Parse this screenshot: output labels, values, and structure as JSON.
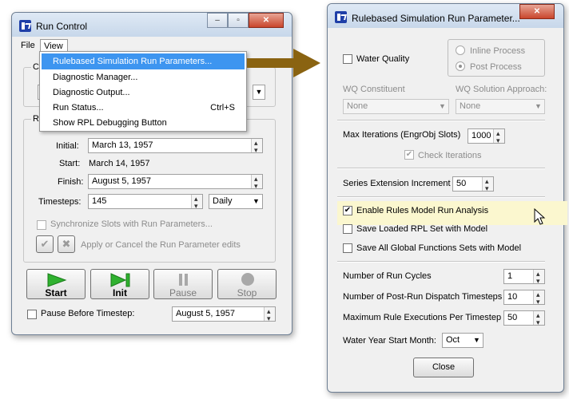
{
  "run_control": {
    "title": "Run Control",
    "menubar": {
      "file": "File",
      "view": "View"
    },
    "view_menu": [
      {
        "label": "Rulebased Simulation Run Parameters...",
        "shortcut": ""
      },
      {
        "label": "Diagnostic Manager...",
        "shortcut": ""
      },
      {
        "label": "Diagnostic Output...",
        "shortcut": ""
      },
      {
        "label": "Run Status...",
        "shortcut": "Ctrl+S"
      },
      {
        "label": "Show RPL Debugging Button",
        "shortcut": ""
      }
    ],
    "group1_title_fragment": "C",
    "group2_title_fragment": "R",
    "initial_label": "Initial:",
    "initial_value": "March 13, 1957",
    "start_label": "Start:",
    "start_value": "March 14, 1957",
    "finish_label": "Finish:",
    "finish_value": "August 5, 1957",
    "timesteps_label": "Timesteps:",
    "timesteps_value": "145",
    "timestep_unit": "Daily",
    "sync_label": "Synchronize Slots with Run Parameters...",
    "apply_label": "Apply or Cancel the Run Parameter edits",
    "buttons": {
      "start": "Start",
      "init": "Init",
      "pause": "Pause",
      "stop": "Stop"
    },
    "pause_before_label": "Pause Before Timestep:",
    "pause_before_value": "August 5, 1957"
  },
  "rbs": {
    "title": "Rulebased Simulation Run Parameter...",
    "water_quality_label": "Water Quality",
    "inline_process": "Inline Process",
    "post_process": "Post Process",
    "wq_constituent_label": "WQ Constituent",
    "wq_constituent_value": "None",
    "wq_solution_label": "WQ Solution Approach:",
    "wq_solution_value": "None",
    "max_iter_label": "Max Iterations  (EngrObj Slots)",
    "max_iter_value": "1000",
    "check_iter_label": "Check Iterations",
    "series_ext_label": "Series Extension Increment",
    "series_ext_value": "50",
    "enable_rules_label": "Enable Rules Model Run Analysis",
    "save_rpl_label": "Save Loaded RPL Set with Model",
    "save_global_label": "Save All Global Functions Sets with Model",
    "run_cycles_label": "Number of Run Cycles",
    "run_cycles_value": "1",
    "post_run_label": "Number of Post-Run Dispatch Timesteps",
    "post_run_value": "10",
    "max_rule_label": "Maximum Rule Executions Per Timestep",
    "max_rule_value": "50",
    "wy_start_label": "Water Year Start Month:",
    "wy_start_value": "Oct",
    "close_label": "Close"
  },
  "colors": {
    "arrow": "#8a6311",
    "highlight": "#3d95f0",
    "run_green": "#2fb12f",
    "row_highlight": "#fbf7cf"
  }
}
